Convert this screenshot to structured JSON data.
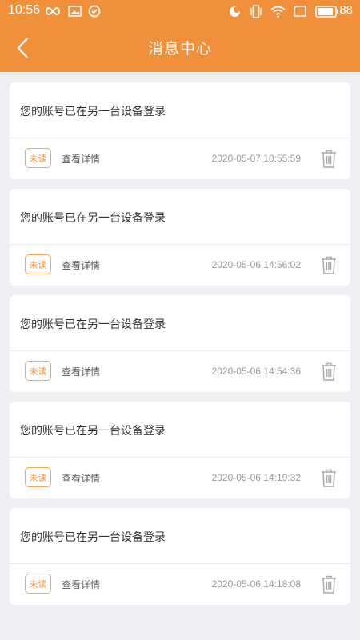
{
  "status_bar": {
    "time": "10:56",
    "battery": "88",
    "left_icons": [
      "infinity-icon",
      "image-icon",
      "check-circle-icon"
    ],
    "right_icons": [
      "moon-icon",
      "vibrate-icon",
      "wifi-icon",
      "screen-icon",
      "battery-icon"
    ]
  },
  "header": {
    "title": "消息中心",
    "back_icon": "chevron-left-icon",
    "color": "#f0903a"
  },
  "messages": [
    {
      "text": "您的账号已在另一台设备登录",
      "badge": "未读",
      "action": "查看详情",
      "time": "2020-05-07 10:55:59"
    },
    {
      "text": "您的账号已在另一台设备登录",
      "badge": "未读",
      "action": "查看详情",
      "time": "2020-05-06 14:56:02"
    },
    {
      "text": "您的账号已在另一台设备登录",
      "badge": "未读",
      "action": "查看详情",
      "time": "2020-05-06 14:54:36"
    },
    {
      "text": "您的账号已在另一台设备登录",
      "badge": "未读",
      "action": "查看详情",
      "time": "2020-05-06 14:19:32"
    },
    {
      "text": "您的账号已在另一台设备登录",
      "badge": "未读",
      "action": "查看详情",
      "time": "2020-05-06 14:18:08"
    }
  ]
}
